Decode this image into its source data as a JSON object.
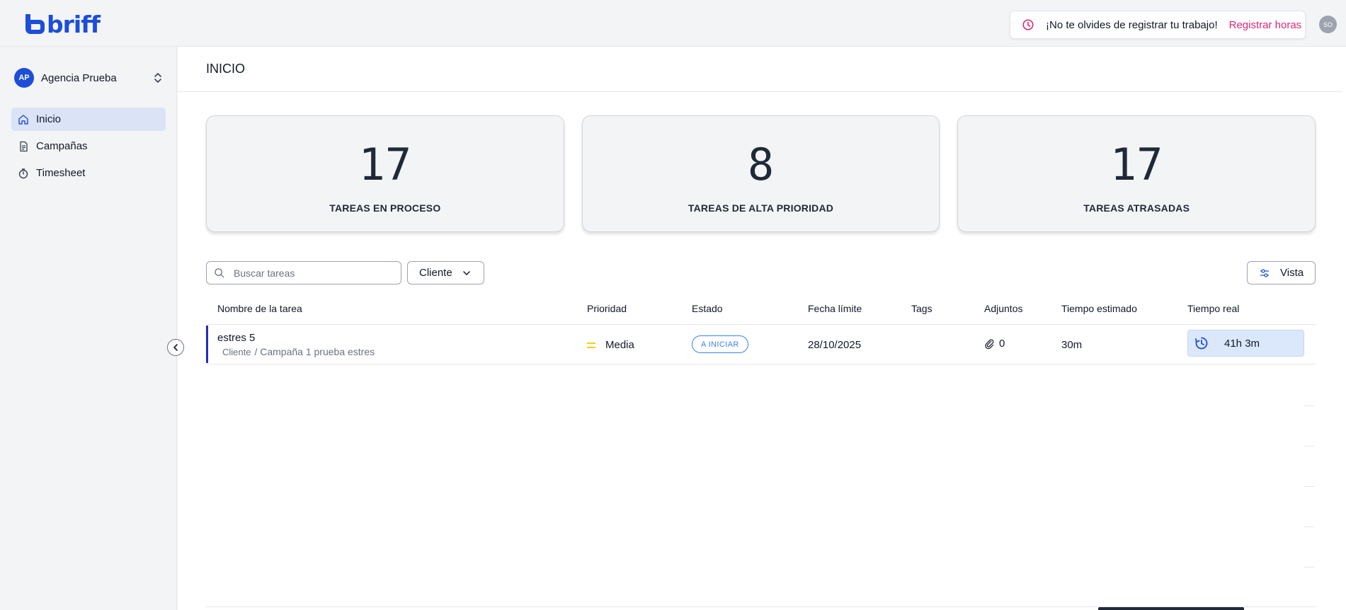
{
  "app": {
    "logo_text": "briff"
  },
  "header": {
    "reminder_text": "¡No te olvides de registrar tu trabajo!",
    "reminder_link": "Registrar horas",
    "user_initials": "SO"
  },
  "sidebar": {
    "org_initials": "AP",
    "org_name": "Agencia Prueba",
    "items": [
      {
        "label": "Inicio",
        "icon": "home-icon",
        "active": true
      },
      {
        "label": "Campañas",
        "icon": "document-icon",
        "active": false
      },
      {
        "label": "Timesheet",
        "icon": "stopwatch-icon",
        "active": false
      }
    ]
  },
  "page": {
    "title": "INICIO"
  },
  "stats": [
    {
      "value": "17",
      "label": "TAREAS EN PROCESO"
    },
    {
      "value": "8",
      "label": "TAREAS DE ALTA PRIORIDAD"
    },
    {
      "value": "17",
      "label": "TAREAS ATRASADAS"
    }
  ],
  "toolbar": {
    "search_placeholder": "Buscar tareas",
    "client_filter": "Cliente",
    "view_button": "Vista"
  },
  "table": {
    "columns": [
      "Nombre de la tarea",
      "Prioridad",
      "Estado",
      "Fecha límite",
      "Tags",
      "Adjuntos",
      "Tiempo estimado",
      "Tiempo real"
    ],
    "rows": [
      {
        "name": "estres 5",
        "client": "Cliente",
        "campaign": "/ Campaña 1 prueba estres",
        "priority": "Media",
        "status": "A INICIAR",
        "due_date": "28/10/2025",
        "tags": "",
        "attachments": "0",
        "estimated": "30m",
        "real": "41h 3m"
      }
    ]
  },
  "colors": {
    "brand": "#1d4ed8",
    "link": "#db2777",
    "status_blue": "#3b82f6",
    "priority_medium": "#facc15"
  }
}
